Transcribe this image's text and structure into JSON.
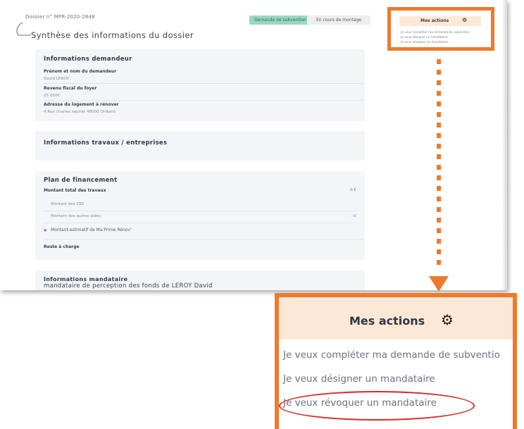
{
  "dossier": {
    "number": "Dossier n° MPR-2020-2848",
    "badge_status": "Demande de subvention",
    "badge_stage": "En cours de montage",
    "title": "Synthèse des informations du dossier"
  },
  "applicant": {
    "title": "Informations demandeur",
    "name_label": "Prénom et nom du demandeur",
    "name_value": "David LEROY",
    "income_label": "Revenu fiscal du foyer",
    "income_value": "25 000€",
    "address_label": "Adresse du logement à rénover",
    "address_value": "4 Rue charles sauriat 48000 Orléans"
  },
  "works": {
    "title": "Informations travaux / entreprises"
  },
  "financing": {
    "title": "Plan de financement",
    "total_label": "Montant total des travaux",
    "total_value": "0 €",
    "cee_label": "Montant des CEE",
    "other_aid_label": "Montant des autres aides",
    "other_aid_value": "–€",
    "estimate_label": "Montant estimatif de Ma Prime Rénov'",
    "remaining_label": "Reste à charge"
  },
  "mandataire": {
    "title": "Informations mandataire",
    "subtitle": "mandataire de perception des fonds de LEROY David"
  },
  "actions": {
    "title": "Mes actions",
    "items": [
      "Je veux compléter ma demande de subvention",
      "Je veux désigner un mandataire",
      "Je veux révoquer un mandataire"
    ],
    "zoom_items": [
      "Je veux compléter ma demande de subventio",
      "Je veux désigner un mandataire",
      "Je veux révoquer un mandataire"
    ]
  },
  "icons": {
    "settings": "gear-icon",
    "back": "back-arrow-icon",
    "connector": "dotted-arrow-icon"
  },
  "colors": {
    "highlight_border": "#ef7a2c",
    "actions_header_bg": "#fbe8d6",
    "status_badge_bg": "#9ad7bd",
    "circle_annotation": "#d82828"
  }
}
